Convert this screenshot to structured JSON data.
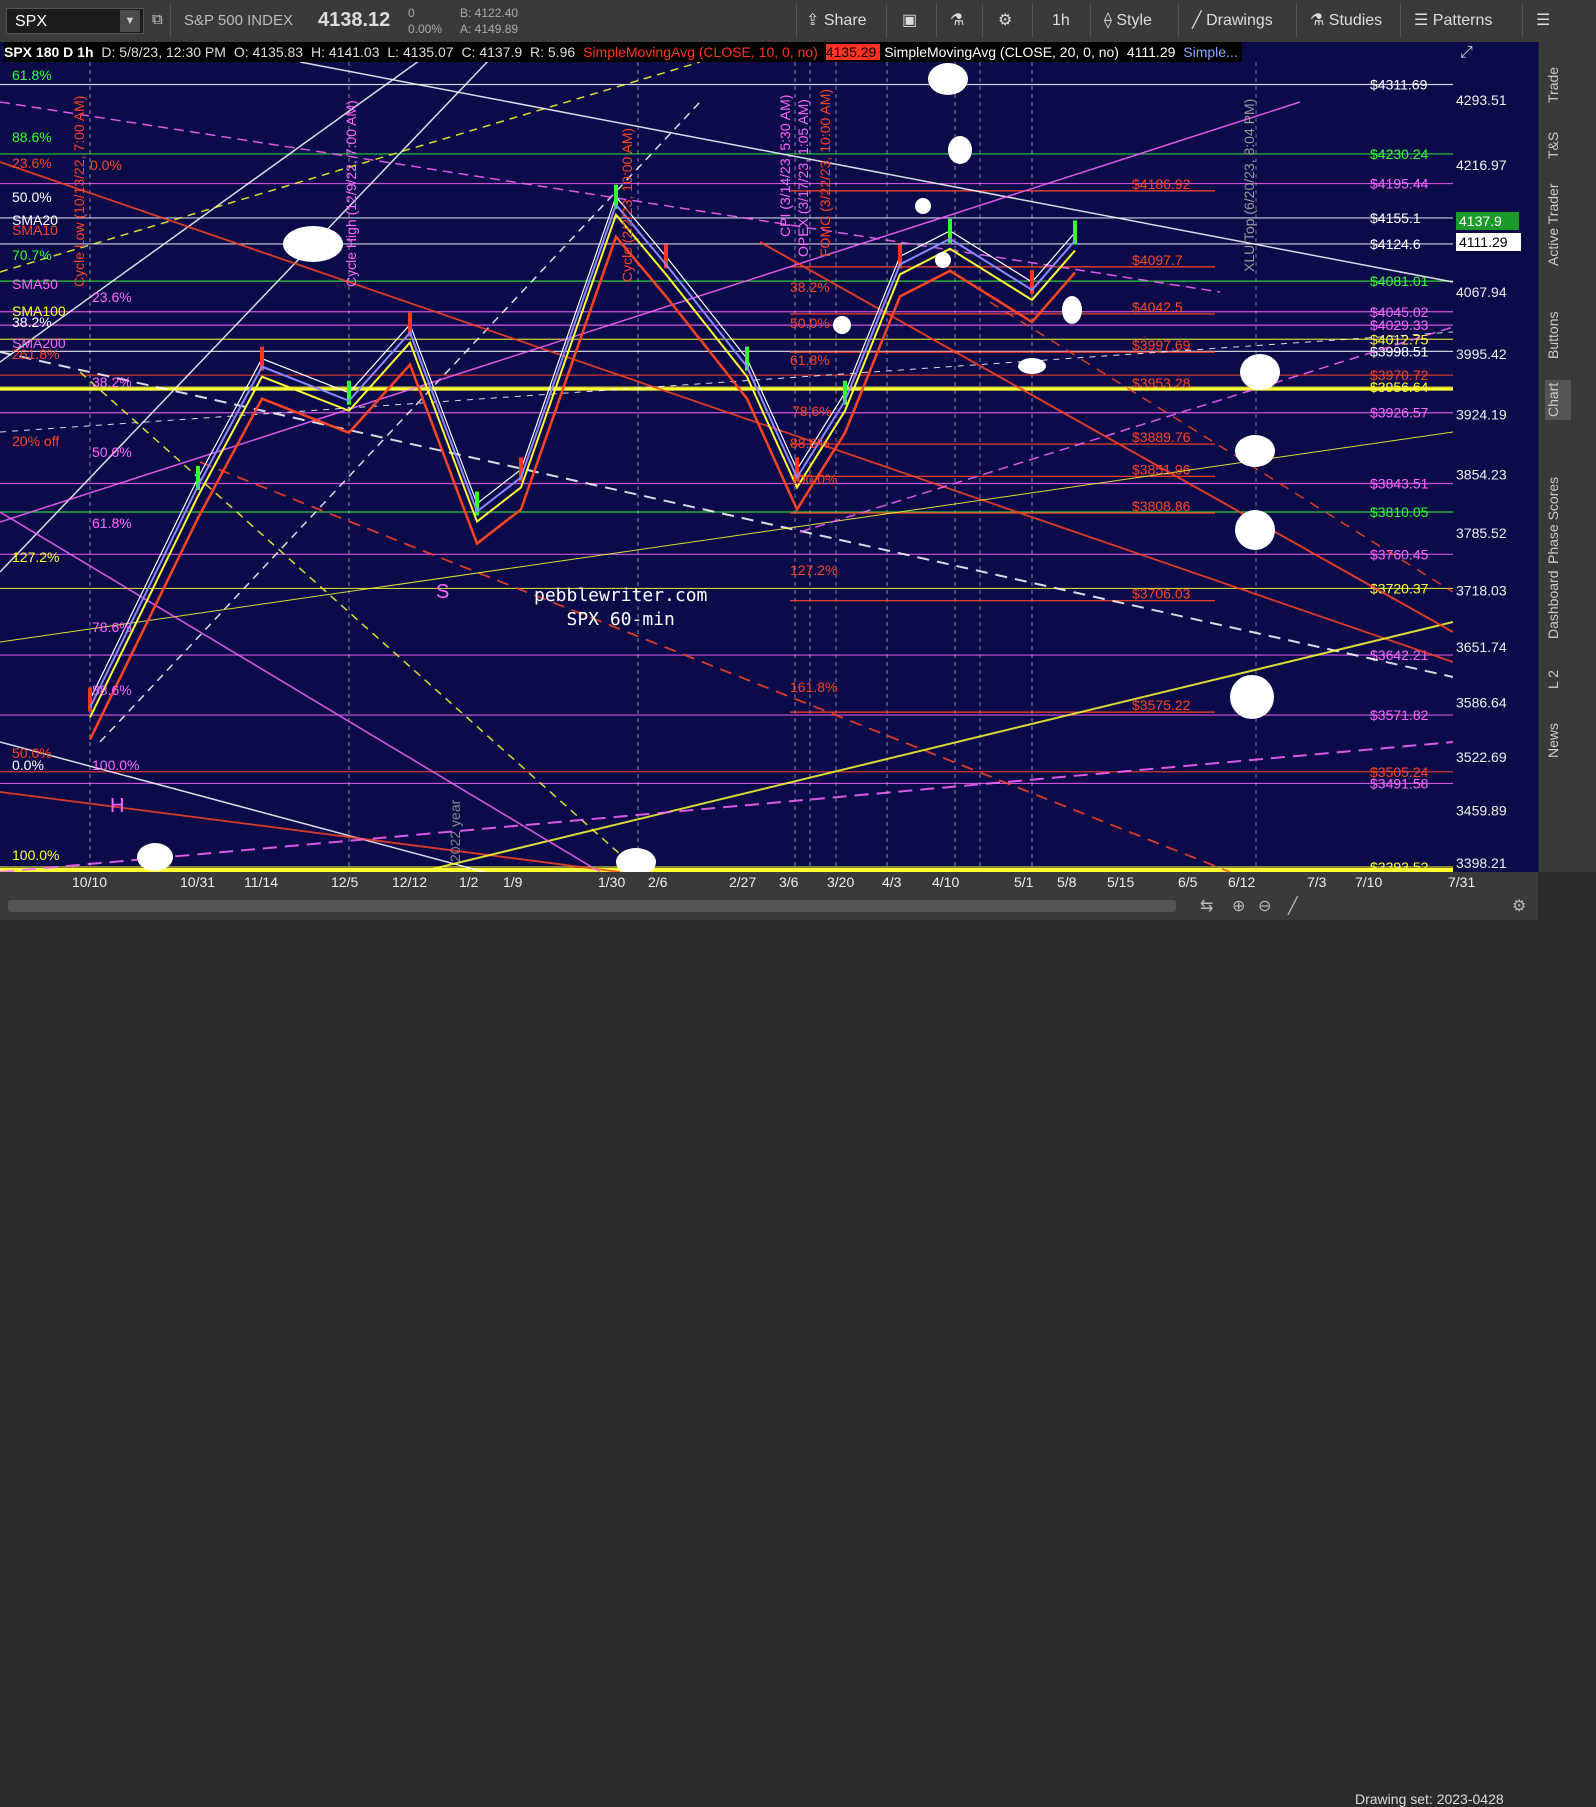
{
  "toolbar": {
    "symbol": "SPX",
    "name": "S&P 500 INDEX",
    "price": "4138.12",
    "change": "0",
    "change_pct": "0.00%",
    "bid": "B: 4122.40",
    "ask": "A: 4149.89",
    "share_label": "Share",
    "interval_label": "1h",
    "style_label": "Style",
    "drawings_label": "Drawings",
    "studies_label": "Studies",
    "patterns_label": "Patterns"
  },
  "header": {
    "title": "SPX 180 D 1h",
    "date": "D: 5/8/23, 12:30 PM",
    "open": "O: 4135.83",
    "high": "H: 4141.03",
    "low": "L: 4135.07",
    "close": "C: 4137.9",
    "range": "R: 5.96",
    "sma10_label": "SimpleMovingAvg (CLOSE, 10, 0, no)",
    "sma10_value": "4135.29",
    "sma20_label": "SimpleMovingAvg (CLOSE, 20, 0, no)",
    "sma20_value": "4111.29",
    "more": "Simple..."
  },
  "right_tabs": [
    "Trade",
    "T&S",
    "Active Trader",
    "Buttons",
    "Chart",
    "Phase Scores",
    "Dashboard",
    "L 2",
    "News"
  ],
  "bottom": {
    "drawing_set": "Drawing set: 2023-0428"
  },
  "watermark": {
    "line1": "pebblewriter.com",
    "line2": "SPX 60-min"
  },
  "colors": {
    "background": "#0b0b4a",
    "sma10": "#ff4422",
    "sma20": "#ffff33",
    "accent_green": "#1a9a2a"
  },
  "chart_data": {
    "type": "line",
    "title": "SPX 180 D 1h",
    "ylim": [
      3398.21,
      4328
    ],
    "x_ticks": [
      "10/10",
      "10/31",
      "11/14",
      "12/5",
      "12/12",
      "1/2",
      "1/9",
      "1/30",
      "2/6",
      "2/27",
      "3/6",
      "3/20",
      "4/3",
      "4/10",
      "5/1",
      "5/8",
      "5/15",
      "6/5",
      "6/12",
      "7/3",
      "7/10",
      "7/31"
    ],
    "y_ticks": [
      4293.51,
      4216.97,
      4067.94,
      3995.42,
      3924.19,
      3854.23,
      3785.52,
      3718.03,
      3651.74,
      3586.64,
      3522.69,
      3459.89,
      3398.21
    ],
    "right_labels": [
      {
        "text": "$4311.69",
        "value": 4311.69
      },
      {
        "text": "$4230.24",
        "value": 4230.24
      },
      {
        "text": "$4195.44",
        "value": 4195.44
      },
      {
        "text": "$4155.1",
        "value": 4155.1
      },
      {
        "text": "$4124.6",
        "value": 4124.6
      },
      {
        "text": "$4081.01",
        "value": 4081.01
      },
      {
        "text": "$4045.02",
        "value": 4045.02
      },
      {
        "text": "$4029.33",
        "value": 4029.33
      },
      {
        "text": "$4012.75",
        "value": 4012.75
      },
      {
        "text": "$3998.51",
        "value": 3998.51
      },
      {
        "text": "$3970.72",
        "value": 3970.72
      },
      {
        "text": "$3956.64",
        "value": 3956.64
      },
      {
        "text": "$3926.57",
        "value": 3926.57
      },
      {
        "text": "$3843.51",
        "value": 3843.51
      },
      {
        "text": "$3810.05",
        "value": 3810.05
      },
      {
        "text": "$3760.45",
        "value": 3760.45
      },
      {
        "text": "$3720.37",
        "value": 3720.37
      },
      {
        "text": "$3642.21",
        "value": 3642.21
      },
      {
        "text": "$3571.82",
        "value": 3571.82
      },
      {
        "text": "$3505.24",
        "value": 3505.24
      },
      {
        "text": "$3491.58",
        "value": 3491.58
      },
      {
        "text": "$3393.52",
        "value": 3393.52
      }
    ],
    "red_labels": [
      {
        "text": "$4186.92",
        "value": 4186.92
      },
      {
        "text": "$4097.7",
        "value": 4097.7
      },
      {
        "text": "$4042.5",
        "value": 4042.5
      },
      {
        "text": "$3997.69",
        "value": 3997.69
      },
      {
        "text": "$3953.28",
        "value": 3953.28
      },
      {
        "text": "$3889.76",
        "value": 3889.76
      },
      {
        "text": "$3851.96",
        "value": 3851.96
      },
      {
        "text": "$3808.86",
        "value": 3808.86
      },
      {
        "text": "$3706.03",
        "value": 3706.03
      },
      {
        "text": "$3575.22",
        "value": 3575.22
      }
    ],
    "left_fib_labels": [
      "61.8%",
      "88.6%",
      "23.6%",
      "50.0%",
      "70.7%",
      "38.2%",
      "261.8%",
      "20% off",
      "127.2%",
      "100.0%",
      "50.0%",
      "0.0%"
    ],
    "fib_labels_mid": [
      "0.0%",
      "23.6%",
      "38.2%",
      "50.0%",
      "61.8%",
      "78.6%",
      "88.6%",
      "100.0%"
    ],
    "fib_labels_center": [
      "38.2%",
      "50.0%",
      "61.8%",
      "78.6%",
      "88.6%",
      "100.0%",
      "127.2%",
      "161.8%"
    ],
    "sma_labels": [
      "SMA20",
      "SMA10",
      "SMA50",
      "SMA100",
      "SMA200"
    ],
    "event_labels": [
      "Cycle Low (10/13/22, 7:00 AM)",
      "Cycle High (12/9/22, 7:00 AM)",
      "Cycle (2/2/23, 10:00 AM)",
      "CPI (3/14/23, 5:30 AM)",
      "OPEX (3/17/23, 1:05 AM)",
      "FOMC (3/22/23, 10:00 AM)",
      "XLU Top (6/20/23, 8:04 PM)",
      "2022 year"
    ],
    "pattern_labels": [
      "H",
      "S"
    ],
    "current_price": "4137.9",
    "sma20_value": "4111.29",
    "series": [
      {
        "name": "SPX",
        "x": [
          "10/10",
          "10/31",
          "11/14",
          "12/5",
          "12/12",
          "1/2",
          "1/9",
          "1/30",
          "2/6",
          "2/27",
          "3/6",
          "3/20",
          "4/3",
          "4/10",
          "5/1",
          "5/8"
        ],
        "values": [
          3590,
          3850,
          3990,
          3950,
          4030,
          3820,
          3860,
          4180,
          4110,
          3990,
          3860,
          3950,
          4110,
          4140,
          4080,
          4138
        ]
      }
    ]
  }
}
